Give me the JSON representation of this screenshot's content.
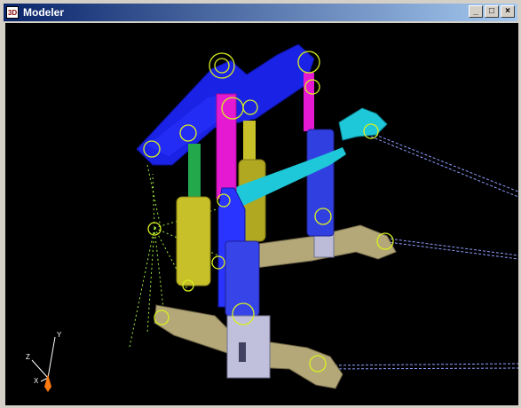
{
  "window": {
    "title": "Modeler",
    "app_icon": "3D",
    "controls": {
      "minimize": "_",
      "maximize": "□",
      "close": "×"
    }
  },
  "viewport": {
    "background": "#000000",
    "axes": {
      "y": "Y",
      "z": "Z",
      "x": "X"
    },
    "colors": {
      "upper_arm": "#1a22e6",
      "pushrod": "#e619d2",
      "tie_rod": "#1fc8d8",
      "strut": "#c8c028",
      "spring_rod": "#23a84c",
      "lower_arm": "#b4a878",
      "marker": "#d8f020",
      "trace": "#8fa0ff"
    }
  }
}
